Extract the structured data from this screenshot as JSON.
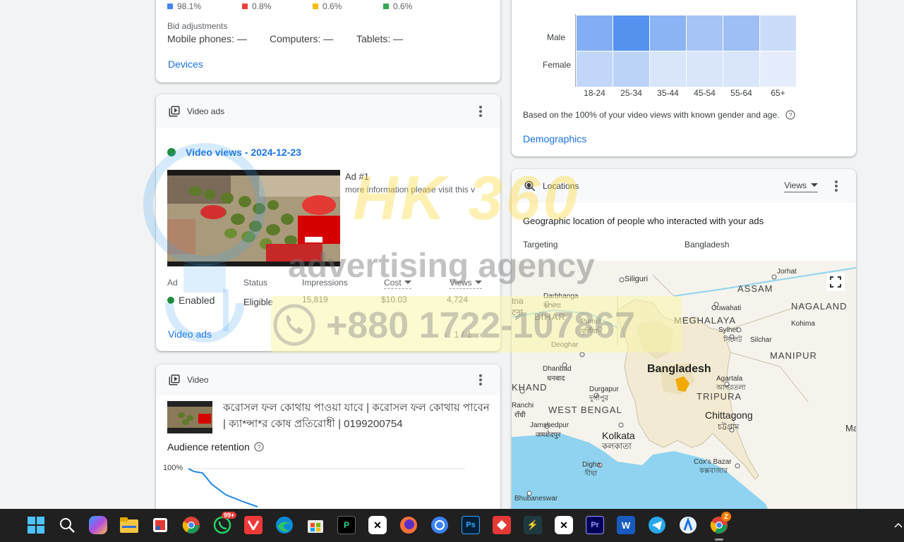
{
  "devices": {
    "shares": [
      {
        "value": "98.1%",
        "color": "#4285f4"
      },
      {
        "value": "0.8%",
        "color": "#ea4335"
      },
      {
        "value": "0.6%",
        "color": "#fbbc04"
      },
      {
        "value": "0.6%",
        "color": "#34a853"
      }
    ],
    "bid_adjustments_label": "Bid adjustments",
    "mobile": "Mobile phones: —",
    "computers": "Computers: —",
    "tablets": "Tablets: —",
    "link": "Devices"
  },
  "video_ads": {
    "title": "Video ads",
    "views_date": "Video views - 2024-12-23",
    "ad_name": "Ad #1",
    "ad_desc": "more information please visit this v",
    "cols": {
      "ad": "Ad",
      "status": "Status",
      "impressions": "Impressions",
      "cost": "Cost",
      "views": "Views"
    },
    "row": {
      "ad": "Enabled",
      "status": "Eligible",
      "impressions": "15,819",
      "cost": "$10.03",
      "views": "4,724"
    },
    "pager": "1 / 1",
    "link": "Video ads"
  },
  "video": {
    "title": "Video",
    "video_title": "করোসল ফল কোথায় পাওয়া যাবে | করোসল ফল কোথায় পাবেন | ক্যা*ন্সা*র কোষ প্রতিরোধী | 0199200754",
    "retention_label": "Audience retention",
    "y100": "100%"
  },
  "demographics": {
    "rows": [
      "Male",
      "Female"
    ],
    "cols": [
      "18-24",
      "25-34",
      "35-44",
      "45-54",
      "55-64",
      "65+"
    ],
    "heat": [
      [
        0.6,
        0.85,
        0.55,
        0.4,
        0.45,
        0.2
      ],
      [
        0.25,
        0.28,
        0.12,
        0.12,
        0.12,
        0.05
      ]
    ],
    "note": "Based on the 100% of your video views with known gender and age.",
    "link": "Demographics"
  },
  "locations": {
    "title": "Locations",
    "metric": "Views",
    "headline": "Geographic location of people who interacted with your ads",
    "targeting_label": "Targeting",
    "targeting_value": "Bangladesh",
    "map_labels": {
      "siliguri": "Siliguri",
      "assam": "ASSAM",
      "jorhat": "Jorhat",
      "nagaland": "NAGALAND",
      "guwahati": "Guwahati",
      "kohima": "Kohima",
      "meghalaya": "MEGHALAYA",
      "sylhet": "Sylhet",
      "sylhet_bn": "সিলেট",
      "silchar": "Silchar",
      "manipur": "MANIPUR",
      "darbhanga": "Darbhanga",
      "darbhanga_hi": "दरभंगा",
      "bihar": "BIHAR",
      "purnia": "Purnia",
      "purnia_hi": "पूर्णिया",
      "patna": "tna",
      "patna_hi": "टना",
      "deoghar": "Deoghar",
      "dhanbad": "Dhanbad",
      "dhanbad_hi": "धनबाद",
      "bangladesh": "Bangladesh",
      "agartala": "Agartala",
      "agartala_bn": "আগরতলা",
      "tripura": "TRIPURA",
      "jharkhand": "KHAND",
      "durgapur": "Durgapur",
      "durgapur_bn": "দুর্গাপুর",
      "ranchi": "Ranchi",
      "ranchi_hi": "राँची",
      "west_bengal": "WEST BENGAL",
      "chittagong": "Chittagong",
      "chittagong_bn": "চট্টগ্রাম",
      "jamshedpur": "Jamshedpur",
      "jamshedpur_hi": "जमशेदपुर",
      "kolkata": "Kolkata",
      "kolkata_bn": "কলকাতা",
      "coxs": "Cox's Bazar",
      "coxs_bn": "কক্সবাজার",
      "digha": "Digha",
      "digha_bn": "দীঘা",
      "bhubaneswar": "Bhubaneswar",
      "ma": "Ma"
    }
  },
  "watermark": {
    "brand": "HK 360",
    "tagline": "advertising agency",
    "phone": "+880 1722-107867"
  },
  "taskbar": {
    "whatsapp_badge": "99+",
    "chrome_badge": "Z"
  }
}
